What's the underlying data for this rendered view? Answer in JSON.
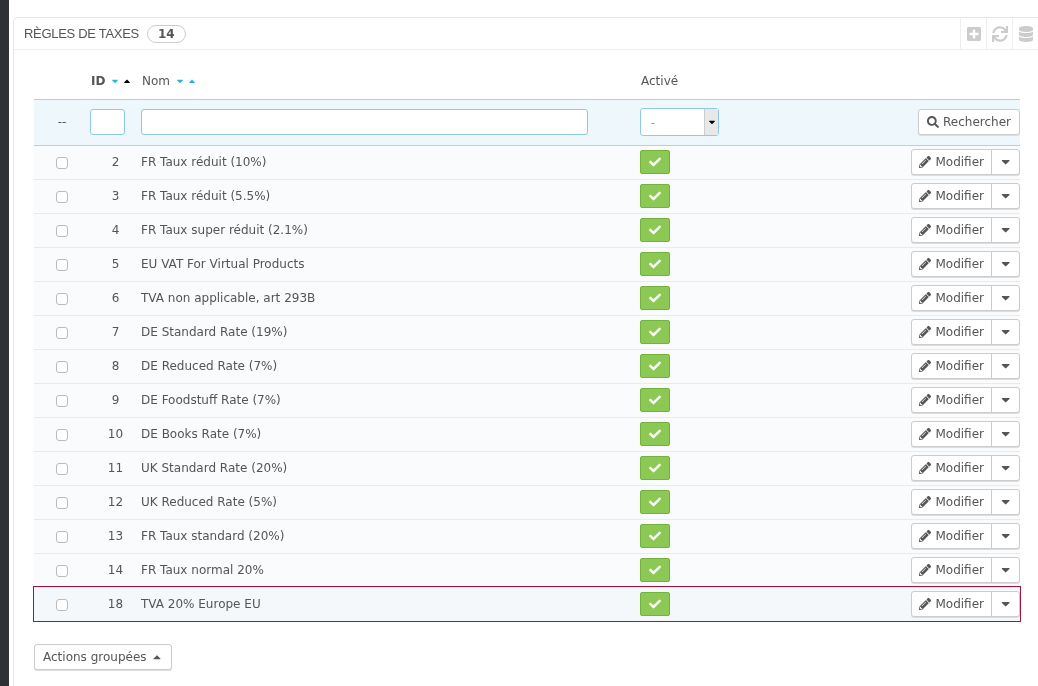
{
  "panel": {
    "title": "RÈGLES DE TAXES",
    "count": "14"
  },
  "columns": [
    {
      "kind": "id",
      "label": "ID",
      "sorted": true
    },
    {
      "kind": "name",
      "label": "Nom",
      "sorted": false
    },
    {
      "kind": "active",
      "label": "Activé"
    }
  ],
  "filter": {
    "reset": "--",
    "active_value": "-",
    "search_button": "Rechercher"
  },
  "rows": [
    {
      "id": "2",
      "name": "FR Taux réduit (10%)",
      "active": true,
      "checked": false,
      "selected": false,
      "button": "Modifier"
    },
    {
      "id": "3",
      "name": "FR Taux réduit (5.5%)",
      "active": true,
      "checked": false,
      "selected": false,
      "button": "Modifier"
    },
    {
      "id": "4",
      "name": "FR Taux super réduit (2.1%)",
      "active": true,
      "checked": false,
      "selected": false,
      "button": "Modifier"
    },
    {
      "id": "5",
      "name": "EU VAT For Virtual Products",
      "active": true,
      "checked": false,
      "selected": false,
      "button": "Modifier"
    },
    {
      "id": "6",
      "name": "TVA non applicable, art 293B",
      "active": true,
      "checked": false,
      "selected": false,
      "button": "Modifier"
    },
    {
      "id": "7",
      "name": "DE Standard Rate (19%)",
      "active": true,
      "checked": false,
      "selected": false,
      "button": "Modifier"
    },
    {
      "id": "8",
      "name": "DE Reduced Rate (7%)",
      "active": true,
      "checked": false,
      "selected": false,
      "button": "Modifier"
    },
    {
      "id": "9",
      "name": "DE Foodstuff Rate (7%)",
      "active": true,
      "checked": false,
      "selected": false,
      "button": "Modifier"
    },
    {
      "id": "10",
      "name": "DE Books Rate (7%)",
      "active": true,
      "checked": false,
      "selected": false,
      "button": "Modifier"
    },
    {
      "id": "11",
      "name": "UK Standard Rate (20%)",
      "active": true,
      "checked": false,
      "selected": false,
      "button": "Modifier"
    },
    {
      "id": "12",
      "name": "UK Reduced Rate (5%)",
      "active": true,
      "checked": false,
      "selected": false,
      "button": "Modifier"
    },
    {
      "id": "13",
      "name": "FR Taux standard (20%)",
      "active": true,
      "checked": false,
      "selected": false,
      "button": "Modifier"
    },
    {
      "id": "14",
      "name": "FR Taux normal 20%",
      "active": true,
      "checked": false,
      "selected": false,
      "button": "Modifier"
    },
    {
      "id": "18",
      "name": "TVA 20% Europe EU",
      "active": true,
      "checked": false,
      "selected": true,
      "button": "Modifier"
    }
  ],
  "bulk_button": "Actions groupées"
}
